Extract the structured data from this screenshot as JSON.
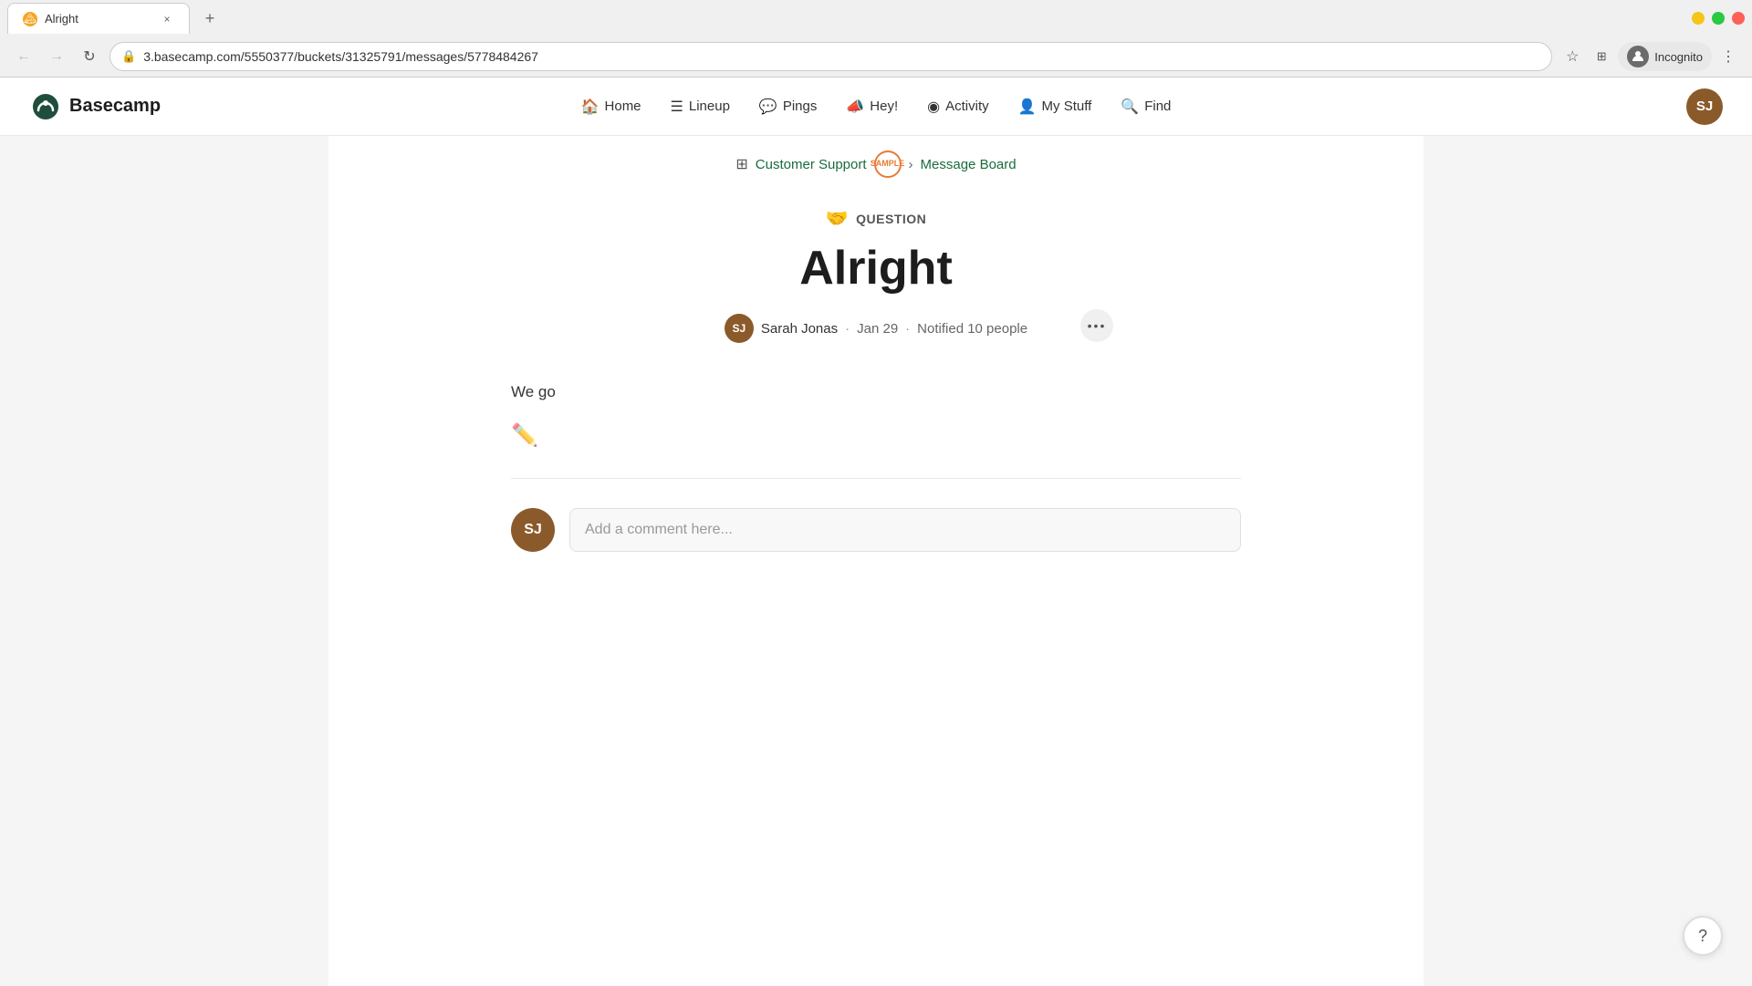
{
  "browser": {
    "tab": {
      "favicon_text": "🏔",
      "title": "Alright",
      "close_label": "×"
    },
    "new_tab_label": "+",
    "toolbar": {
      "back_label": "←",
      "forward_label": "→",
      "reload_label": "↻",
      "url": "3.basecamp.com/5550377/buckets/31325791/messages/5778484267",
      "bookmark_label": "☆",
      "extensions_label": "⊞",
      "incognito_label": "Incognito",
      "more_label": "⋮"
    }
  },
  "nav": {
    "logo_text": "Basecamp",
    "links": [
      {
        "id": "home",
        "icon": "🏠",
        "label": "Home"
      },
      {
        "id": "lineup",
        "icon": "☰",
        "label": "Lineup"
      },
      {
        "id": "pings",
        "icon": "💬",
        "label": "Pings"
      },
      {
        "id": "hey",
        "icon": "📣",
        "label": "Hey!"
      },
      {
        "id": "activity",
        "icon": "◉",
        "label": "Activity"
      },
      {
        "id": "mystuff",
        "icon": "👤",
        "label": "My Stuff"
      },
      {
        "id": "find",
        "icon": "🔍",
        "label": "Find"
      }
    ],
    "user_initials": "SJ"
  },
  "breadcrumb": {
    "project_label": "Customer Support",
    "sample_label": "SAMPLE",
    "separator": "›",
    "board_label": "Message Board"
  },
  "message": {
    "type_icon": "🤝",
    "type_label": "QUESTION",
    "title": "Alright",
    "author_initials": "SJ",
    "author_name": "Sarah Jonas",
    "dot1": "·",
    "date": "Jan 29",
    "dot2": "·",
    "notified": "Notified 10 people",
    "body": "We go",
    "emoji_icon": "✏️",
    "more_icon": "•••"
  },
  "comment": {
    "avatar_initials": "SJ",
    "placeholder": "Add a comment here..."
  },
  "help": {
    "icon": "?"
  }
}
